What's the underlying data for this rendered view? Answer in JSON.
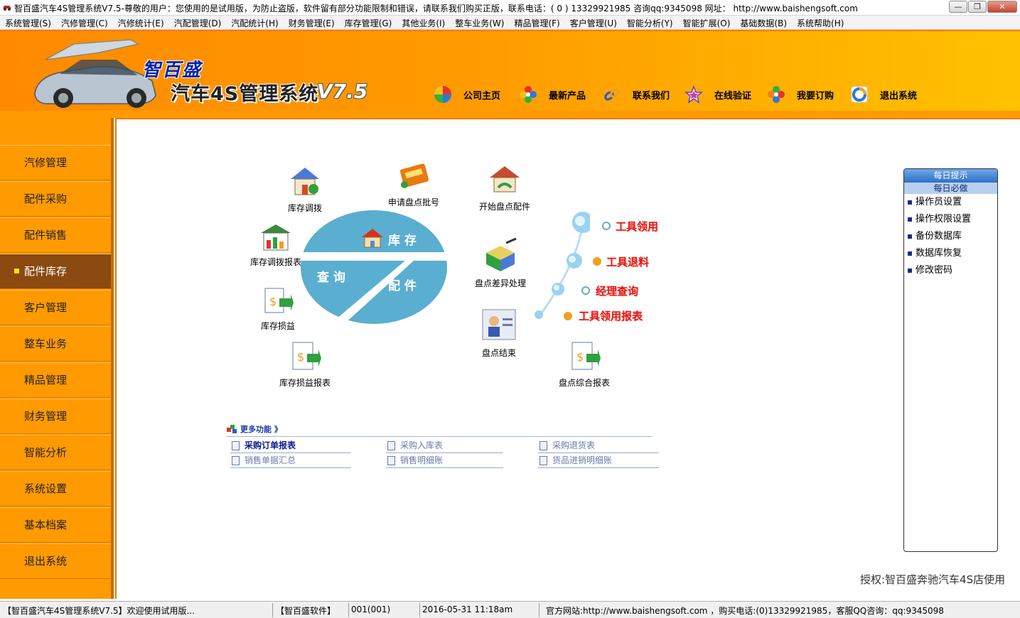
{
  "window": {
    "title": "智百盛汽车4S管理系统V7.5-尊敬的用户：您使用的是试用版，为防止盗版，软件留有部分功能限制和错误，请联系我们购买正版，联系电话：( 0 ) 13329921985  咨询qq:9345098   网址：  http://www.baishengsoft.com",
    "minimize_label": "—",
    "maximize_label": "❐",
    "close_label": "✕"
  },
  "menu": [
    "系统管理(S)",
    "汽修管理(C)",
    "汽修统计(E)",
    "汽配管理(D)",
    "汽配统计(H)",
    "财务管理(E)",
    "库存管理(G)",
    "其他业务(I)",
    "整车业务(W)",
    "精品管理(F)",
    "客户管理(U)",
    "智能分析(Y)",
    "智能扩展(O)",
    "基础数据(B)",
    "系统帮助(H)"
  ],
  "header": {
    "brand": "智百盛",
    "system_title": "汽车4S管理系统",
    "version": "V7.5",
    "nav": [
      {
        "label": "公司主页",
        "icon": "pinwheel-icon"
      },
      {
        "label": "最新产品",
        "icon": "color-wheel-icon"
      },
      {
        "label": "联系我们",
        "icon": "chain-icon"
      },
      {
        "label": "在线验证",
        "icon": "star-icon"
      },
      {
        "label": "我要订购",
        "icon": "flower-icon"
      },
      {
        "label": "退出系统",
        "icon": "ring-icon"
      }
    ]
  },
  "sidebar": {
    "items": [
      {
        "label": "汽修管理"
      },
      {
        "label": "配件采购"
      },
      {
        "label": "配件销售"
      },
      {
        "label": "配件库存",
        "active": true
      },
      {
        "label": "客户管理"
      },
      {
        "label": "整车业务"
      },
      {
        "label": "精品管理"
      },
      {
        "label": "财务管理"
      },
      {
        "label": "智能分析"
      },
      {
        "label": "系统设置"
      },
      {
        "label": "基本档案"
      },
      {
        "label": "退出系统"
      }
    ]
  },
  "center_graphic": {
    "top_text": "库 存",
    "left_text": "查 询",
    "right_text": "配 件"
  },
  "functions": {
    "stock_transfer": "库存调拨",
    "apply_count_batch": "申请盘点批号",
    "start_count": "开始盘点配件",
    "transfer_report": "库存调拨报表",
    "count_diff": "盘点差异处理",
    "stock_pl": "库存损益",
    "count_end": "盘点结束",
    "stock_pl_report": "库存损益报表",
    "count_summary": "盘点综合报表"
  },
  "tools": [
    {
      "label": "工具领用"
    },
    {
      "label": "工具退料"
    },
    {
      "label": "经理查询"
    },
    {
      "label": "工具领用报表"
    }
  ],
  "more": {
    "title": "更多功能 》",
    "links": [
      "采购订单报表",
      "采购入库表",
      "采购退货表",
      "销售单据汇总",
      "销售明细账",
      "货品进销明细账"
    ]
  },
  "tips": {
    "header": "每日提示",
    "sub": "每日必做",
    "items": [
      "操作员设置",
      "操作权限设置",
      "备份数据库",
      "数据库恢复",
      "修改密码"
    ]
  },
  "license": "授权:智百盛奔驰汽车4S店使用",
  "status": {
    "welcome": "【智百盛汽车4S管理系统V7.5】欢迎使用试用版...",
    "company": "【智百盛软件】",
    "user": "001(001)",
    "datetime": "2016-05-31 11:18am",
    "contact": "官方网站:http://www.baishengsoft.com ，购买电话:(0)13329921985，客服QQ咨询：qq:9345098"
  },
  "colors": {
    "header_orange": "#ff9a00",
    "active_sidebar": "#8a4a10",
    "tool_red": "#e21818",
    "disc_blue": "#5aaed0"
  }
}
